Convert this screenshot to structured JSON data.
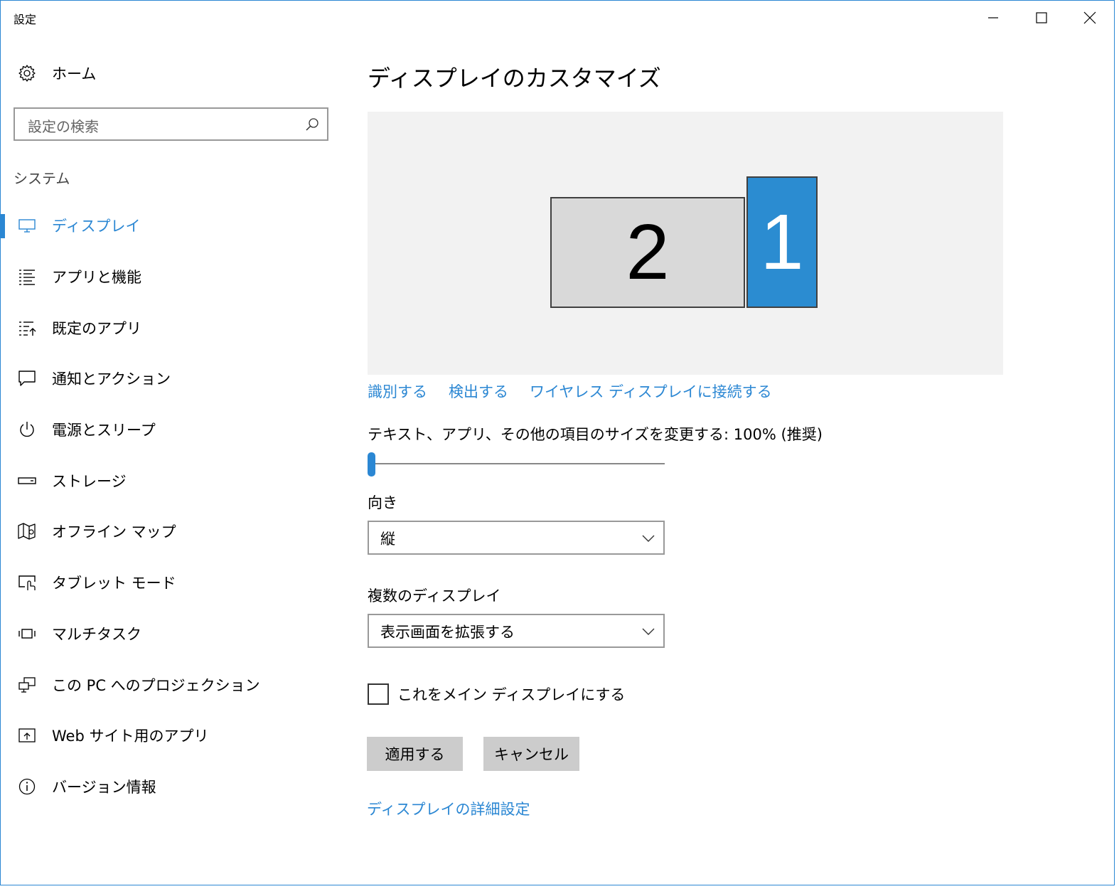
{
  "window": {
    "title": "設定"
  },
  "sidebar": {
    "home_label": "ホーム",
    "search_placeholder": "設定の検索",
    "section_title": "システム",
    "items": [
      {
        "label": "ディスプレイ",
        "icon": "monitor-icon",
        "active": true
      },
      {
        "label": "アプリと機能",
        "icon": "apps-list-icon",
        "active": false
      },
      {
        "label": "既定のアプリ",
        "icon": "default-apps-icon",
        "active": false
      },
      {
        "label": "通知とアクション",
        "icon": "notification-icon",
        "active": false
      },
      {
        "label": "電源とスリープ",
        "icon": "power-icon",
        "active": false
      },
      {
        "label": "ストレージ",
        "icon": "storage-icon",
        "active": false
      },
      {
        "label": "オフライン マップ",
        "icon": "map-icon",
        "active": false
      },
      {
        "label": "タブレット モード",
        "icon": "tablet-mode-icon",
        "active": false
      },
      {
        "label": "マルチタスク",
        "icon": "multitask-icon",
        "active": false
      },
      {
        "label": "この PC へのプロジェクション",
        "icon": "projection-icon",
        "active": false
      },
      {
        "label": "Web サイト用のアプリ",
        "icon": "web-apps-icon",
        "active": false
      },
      {
        "label": "バージョン情報",
        "icon": "info-icon",
        "active": false
      }
    ]
  },
  "main": {
    "title": "ディスプレイのカスタマイズ",
    "monitors": {
      "primary_number": "1",
      "secondary_number": "2",
      "primary_color": "#2b8cd1",
      "secondary_color": "#d9d9d9"
    },
    "links": {
      "identify": "識別する",
      "detect": "検出する",
      "wireless": "ワイヤレス ディスプレイに接続する"
    },
    "scale": {
      "label": "テキスト、アプリ、その他の項目のサイズを変更する: 100% (推奨)",
      "value_fraction": 0
    },
    "orientation": {
      "label": "向き",
      "value": "縦"
    },
    "multiple_displays": {
      "label": "複数のディスプレイ",
      "value": "表示画面を拡張する"
    },
    "main_display_checkbox": {
      "label": "これをメイン ディスプレイにする",
      "checked": false
    },
    "buttons": {
      "apply": "適用する",
      "cancel": "キャンセル"
    },
    "advanced_link": "ディスプレイの詳細設定"
  },
  "colors": {
    "accent": "#2b87d3",
    "button_bg": "#cccccc",
    "preview_bg": "#f2f2f2"
  }
}
